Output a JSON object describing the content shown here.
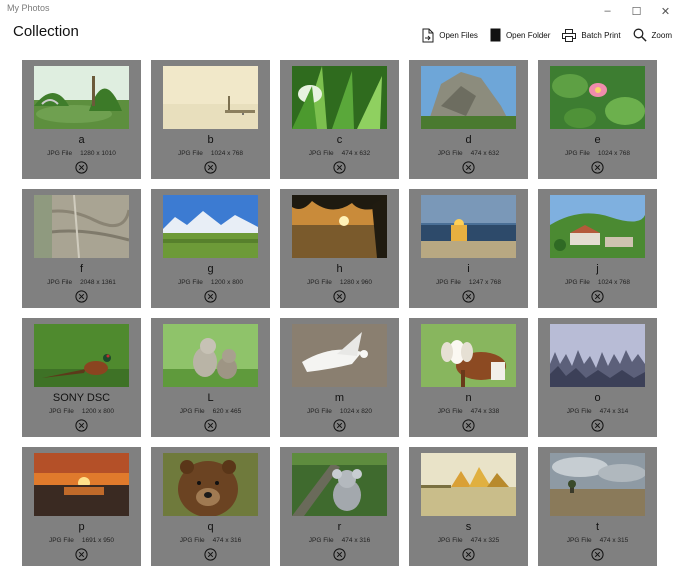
{
  "window": {
    "title": "My Photos",
    "controls": [
      "–",
      "☐",
      "✕"
    ]
  },
  "page": {
    "title": "Collection"
  },
  "toolbar": [
    {
      "name": "open-files-button",
      "icon": "open-file-icon",
      "label": "Open Files"
    },
    {
      "name": "open-folder-button",
      "icon": "folder-icon",
      "label": "Open Folder"
    },
    {
      "name": "batch-print-button",
      "icon": "printer-icon",
      "label": "Batch Print"
    },
    {
      "name": "zoom-button",
      "icon": "search-icon",
      "label": "Zoom"
    }
  ],
  "photos": [
    {
      "name": "a",
      "type": "JPG File",
      "dims": "1280 x 1010",
      "scene": "garden-pond"
    },
    {
      "name": "b",
      "type": "JPG File",
      "dims": "1024 x 768",
      "scene": "hazy-pier"
    },
    {
      "name": "c",
      "type": "JPG File",
      "dims": "474 x 632",
      "scene": "green-leaves"
    },
    {
      "name": "d",
      "type": "JPG File",
      "dims": "474 x 632",
      "scene": "rock-cliff"
    },
    {
      "name": "e",
      "type": "JPG File",
      "dims": "1024 x 768",
      "scene": "lotus-flower"
    },
    {
      "name": "f",
      "type": "JPG File",
      "dims": "2048 x 1361",
      "scene": "stone-wall"
    },
    {
      "name": "g",
      "type": "JPG File",
      "dims": "1200 x 800",
      "scene": "mountain-meadow"
    },
    {
      "name": "h",
      "type": "JPG File",
      "dims": "1280 x 960",
      "scene": "lake-sunset-trees"
    },
    {
      "name": "i",
      "type": "JPG File",
      "dims": "1247 x 768",
      "scene": "sea-sunset"
    },
    {
      "name": "j",
      "type": "JPG File",
      "dims": "1024 x 768",
      "scene": "hill-village"
    },
    {
      "name": "SONY DSC",
      "type": "JPG File",
      "dims": "1200 x 800",
      "scene": "pheasant-grass"
    },
    {
      "name": "L",
      "type": "JPG File",
      "dims": "620 x 465",
      "scene": "kittens-grass"
    },
    {
      "name": "m",
      "type": "JPG File",
      "dims": "1024 x 820",
      "scene": "white-dove"
    },
    {
      "name": "n",
      "type": "JPG File",
      "dims": "474 x 338",
      "scene": "goat-field"
    },
    {
      "name": "o",
      "type": "JPG File",
      "dims": "474 x 314",
      "scene": "misty-forest"
    },
    {
      "name": "p",
      "type": "JPG File",
      "dims": "1691 x 950",
      "scene": "orange-sunset"
    },
    {
      "name": "q",
      "type": "JPG File",
      "dims": "474 x 316",
      "scene": "brown-bear"
    },
    {
      "name": "r",
      "type": "JPG File",
      "dims": "474 x 316",
      "scene": "koala-tree"
    },
    {
      "name": "s",
      "type": "JPG File",
      "dims": "474 x 325",
      "scene": "autumn-lake"
    },
    {
      "name": "t",
      "type": "JPG File",
      "dims": "474 x 315",
      "scene": "cloudy-plain"
    }
  ]
}
